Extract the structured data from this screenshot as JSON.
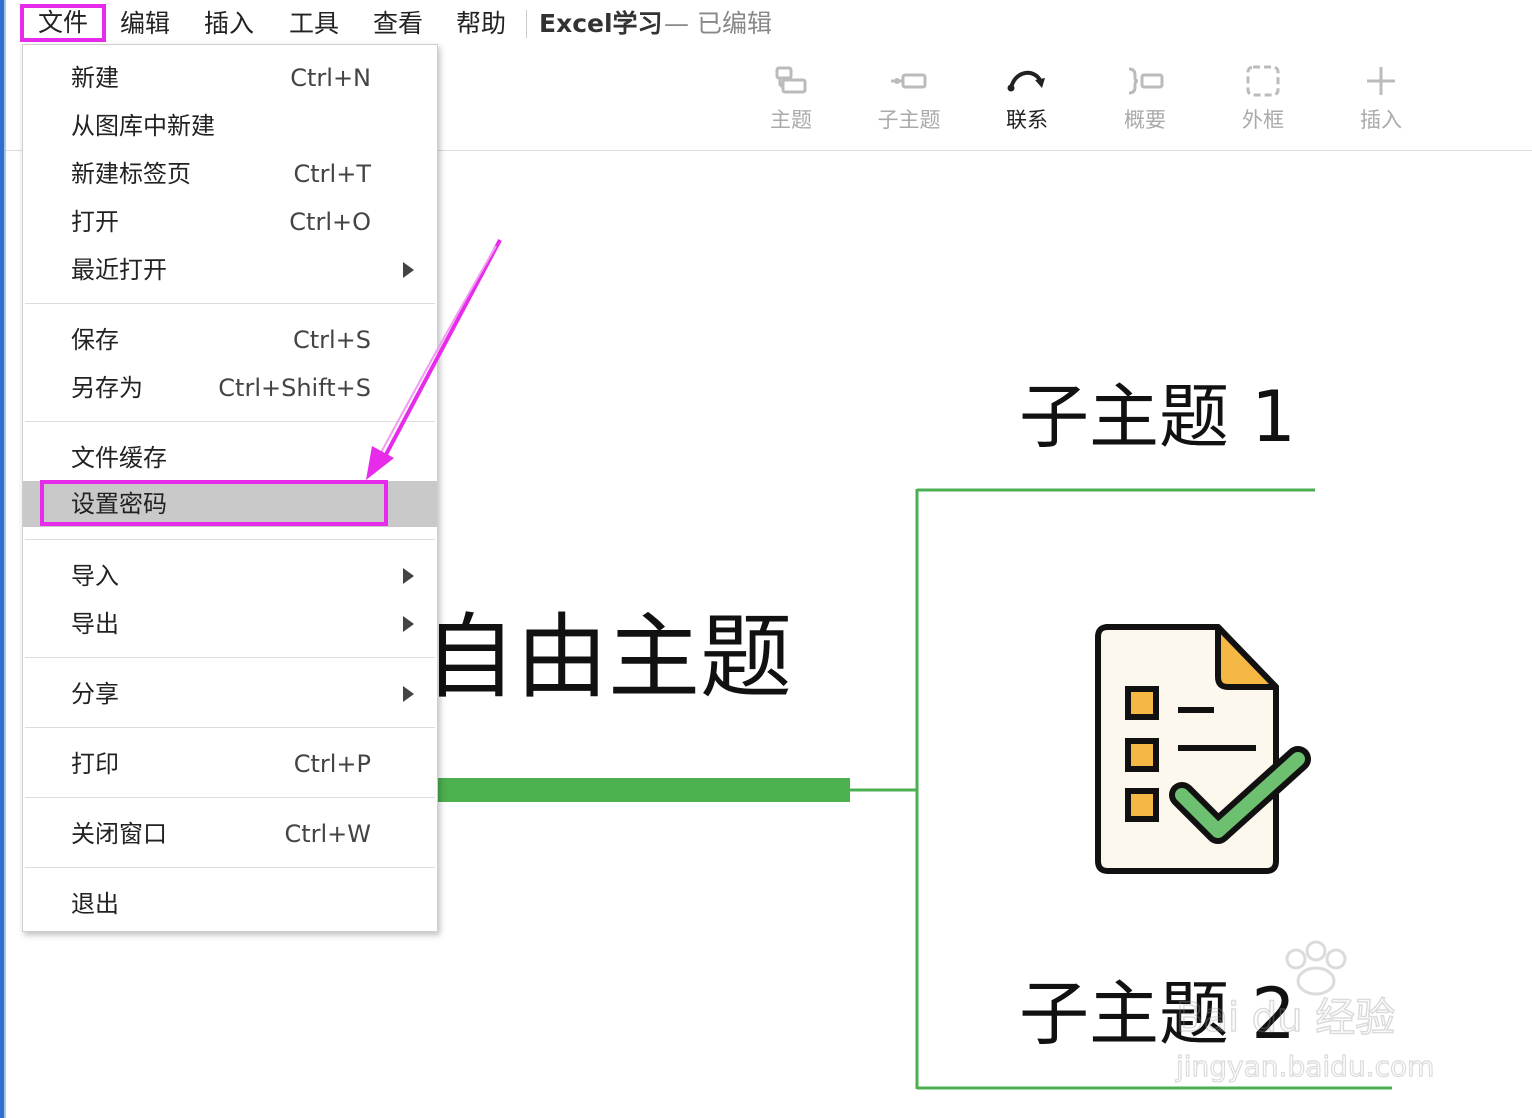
{
  "menubar": {
    "items": [
      "文件",
      "编辑",
      "插入",
      "工具",
      "查看",
      "帮助"
    ],
    "doc_title": "Excel学习",
    "doc_status": "— 已编辑"
  },
  "toolbar": {
    "items": [
      {
        "label": "主题",
        "icon": "topic-icon",
        "enabled": false
      },
      {
        "label": "子主题",
        "icon": "subtopic-icon",
        "enabled": false
      },
      {
        "label": "联系",
        "icon": "relationship-icon",
        "enabled": true
      },
      {
        "label": "概要",
        "icon": "summary-icon",
        "enabled": false
      },
      {
        "label": "外框",
        "icon": "boundary-icon",
        "enabled": false
      },
      {
        "label": "插入",
        "icon": "plus-icon",
        "enabled": false
      }
    ]
  },
  "file_menu": {
    "items": [
      {
        "label": "新建",
        "shortcut": "Ctrl+N"
      },
      {
        "label": "从图库中新建",
        "shortcut": ""
      },
      {
        "label": "新建标签页",
        "shortcut": "Ctrl+T"
      },
      {
        "label": "打开",
        "shortcut": "Ctrl+O"
      },
      {
        "label": "最近打开",
        "shortcut": "",
        "submenu": true
      },
      {
        "label": "保存",
        "shortcut": "Ctrl+S"
      },
      {
        "label": "另存为",
        "shortcut": "Ctrl+Shift+S"
      },
      {
        "label": "文件缓存",
        "shortcut": ""
      },
      {
        "label": "设置密码",
        "shortcut": "",
        "highlighted": true
      },
      {
        "label": "导入",
        "shortcut": "",
        "submenu": true
      },
      {
        "label": "导出",
        "shortcut": "",
        "submenu": true
      },
      {
        "label": "分享",
        "shortcut": "",
        "submenu": true
      },
      {
        "label": "打印",
        "shortcut": "Ctrl+P"
      },
      {
        "label": "关闭窗口",
        "shortcut": "Ctrl+W"
      },
      {
        "label": "退出",
        "shortcut": ""
      }
    ]
  },
  "mindmap": {
    "central_topic": "自由主题",
    "subtopic_1": "子主题 1",
    "subtopic_2": "子主题 2"
  },
  "watermark": {
    "brand": "Bai du 经验",
    "url": "jingyan.baidu.com"
  },
  "colors": {
    "highlight": "#e62bea",
    "branch": "#4caf50",
    "accent_blue": "#2f6fd0"
  }
}
